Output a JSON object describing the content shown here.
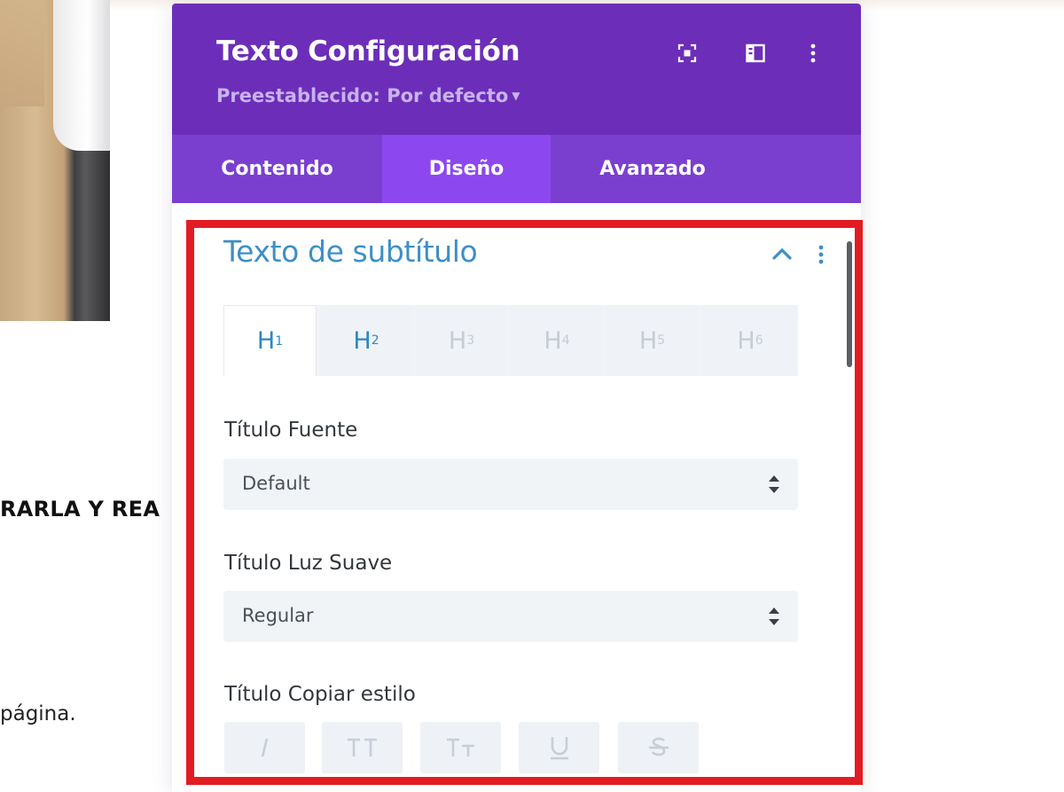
{
  "background": {
    "heading_fragment": "RARLA Y REA",
    "text_fragment": "página."
  },
  "panel": {
    "title": "Texto Configuración",
    "preset": "Preestablecido: Por defecto",
    "header_icons": [
      "expand-icon",
      "split-view-icon",
      "more-vertical-icon"
    ],
    "tabs": [
      {
        "label": "Contenido",
        "active": false
      },
      {
        "label": "Diseño",
        "active": true
      },
      {
        "label": "Avanzado",
        "active": false
      }
    ]
  },
  "section": {
    "title": "Texto de subtítulo",
    "heading_tabs": [
      {
        "base": "H",
        "sub": "1",
        "state": "active"
      },
      {
        "base": "H",
        "sub": "2",
        "state": "enabled"
      },
      {
        "base": "H",
        "sub": "3",
        "state": "disabled"
      },
      {
        "base": "H",
        "sub": "4",
        "state": "disabled"
      },
      {
        "base": "H",
        "sub": "5",
        "state": "disabled"
      },
      {
        "base": "H",
        "sub": "6",
        "state": "disabled"
      }
    ],
    "font_label": "Título Fuente",
    "font_value": "Default",
    "weight_label": "Título Luz Suave",
    "weight_value": "Regular",
    "style_label": "Título Copiar estilo",
    "style_buttons": [
      "italic-icon",
      "uppercase-icon",
      "small-caps-icon",
      "underline-icon",
      "strikethrough-icon"
    ]
  },
  "colors": {
    "header_purple": "#6c2eb9",
    "tabs_purple": "#7b3fd0",
    "active_tab": "#8c48ee",
    "section_blue": "#3d8fc6",
    "highlight_red": "#e31c23"
  }
}
